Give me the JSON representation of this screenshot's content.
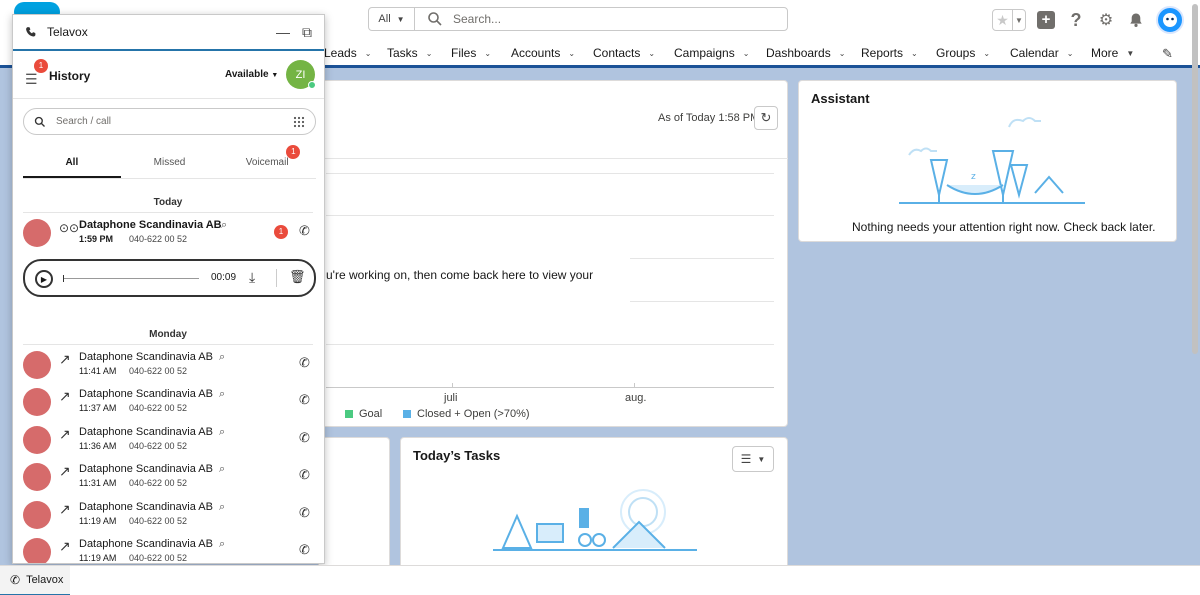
{
  "header": {
    "search_scope": "All",
    "search_placeholder": "Search..."
  },
  "nav": {
    "items": [
      "Leads",
      "Tasks",
      "Files",
      "Accounts",
      "Contacts",
      "Campaigns",
      "Dashboards",
      "Reports",
      "Groups",
      "Calendar",
      "More"
    ]
  },
  "chart_card": {
    "as_of": "As of Today 1:58 PM",
    "message": "u're working on, then come back here to view your",
    "x_ticks": [
      "juli",
      "aug."
    ],
    "legend": [
      "Goal",
      "Closed + Open (>70%)"
    ]
  },
  "assistant": {
    "title": "Assistant",
    "message": "Nothing needs your attention right now. Check back later."
  },
  "tasks": {
    "title": "Today’s Tasks"
  },
  "telavox": {
    "window_title": "Telavox",
    "menu_badge": "1",
    "section_title": "History",
    "status": "Available",
    "user_initials": "ZI",
    "search_placeholder": "Search / call",
    "tabs": [
      {
        "label": "All"
      },
      {
        "label": "Missed"
      },
      {
        "label": "Voicemail",
        "badge": "1"
      }
    ],
    "days": [
      "Today",
      "Monday"
    ],
    "today_calls": [
      {
        "name": "Dataphone Scandinavia AB",
        "time": "1:59 PM",
        "number": "040-622 00 52",
        "badge": "1"
      }
    ],
    "player": {
      "duration": "00:09"
    },
    "monday_calls": [
      {
        "name": "Dataphone Scandinavia AB",
        "time": "11:41 AM",
        "number": "040-622 00 52"
      },
      {
        "name": "Dataphone Scandinavia AB",
        "time": "11:37 AM",
        "number": "040-622 00 52"
      },
      {
        "name": "Dataphone Scandinavia AB",
        "time": "11:36 AM",
        "number": "040-622 00 52"
      },
      {
        "name": "Dataphone Scandinavia AB",
        "time": "11:31 AM",
        "number": "040-622 00 52"
      },
      {
        "name": "Dataphone Scandinavia AB",
        "time": "11:19 AM",
        "number": "040-622 00 52"
      },
      {
        "name": "Dataphone Scandinavia AB",
        "time": "11:19 AM",
        "number": "040-622 00 52"
      }
    ]
  },
  "footer": {
    "tab_label": "Telavox"
  },
  "colors": {
    "accent": "#1b5297",
    "goal": "#4bca81",
    "closed_open": "#5ab0e6",
    "missed_avatar": "#d66b6b"
  }
}
